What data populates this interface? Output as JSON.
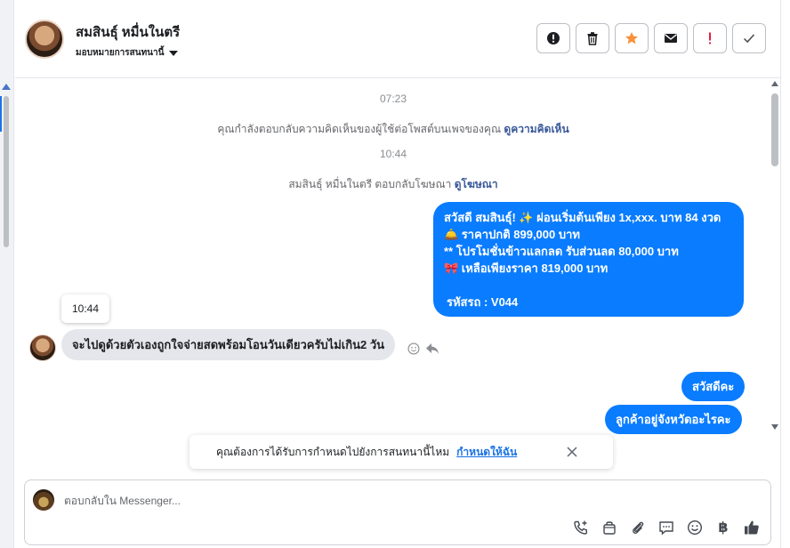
{
  "header": {
    "contact_name": "สมสินธุ์ หมื่นในตรี",
    "assign_label": "มอบหมายการสนทนานี้"
  },
  "actions": [
    {
      "name": "alert-action",
      "icon": "exclamation-circle-icon"
    },
    {
      "name": "delete-action",
      "icon": "trash-icon"
    },
    {
      "name": "star-action",
      "icon": "star-icon"
    },
    {
      "name": "mail-action",
      "icon": "envelope-icon"
    },
    {
      "name": "priority-action",
      "icon": "exclamation-icon"
    },
    {
      "name": "done-action",
      "icon": "check-icon"
    }
  ],
  "conversation": {
    "time1": "07:23",
    "sys1_text": "คุณกำลังตอบกลับความคิดเห็นของผู้ใช้ต่อโพสต์บนเพจของคุณ",
    "sys1_link": "ดูความคิดเห็น",
    "time2": "10:44",
    "sys2_text": "สมสินธุ์ หมื่นในตรี ตอบกลับโฆษณา",
    "sys2_link": "ดูโฆษณา",
    "ad_message": {
      "line1": "สวัสดี สมสินธุ์! ✨  ผ่อนเริ่มต้นเพียง 1x,xxx. บาท 84 งวด",
      "line2": "🛎️ ราคาปกติ 899,000 บาท",
      "line3": "** โปรโมชั่นข้าวแลกลด รับส่วนลด 80,000 บาท",
      "line4": "🎀  เหลือเพียงราคา 819,000 บาท",
      "line5": "รหัสรถ : V044"
    },
    "tooltip_time": "10:44",
    "incoming_message": "จะไปดูด้วยตัวเองถูกใจจ่ายสดพร้อมโอนวันเดียวครับไม่เกิน2 วัน",
    "out_msg1": "สวัสดีคะ",
    "out_msg2": "ลูกค้าอยู่จังหวัดอะไรคะ"
  },
  "notice": {
    "text": "คุณต้องการได้รับการกำหนดไปยังการสนทนานี้ไหม",
    "link": "กำหนดให้ฉัน"
  },
  "composer": {
    "placeholder": "ตอบกลับใน Messenger...",
    "baht_symbol": "฿"
  },
  "colors": {
    "accent": "#0a7cff",
    "star": "#f7923b",
    "priority": "#e41e3f"
  }
}
